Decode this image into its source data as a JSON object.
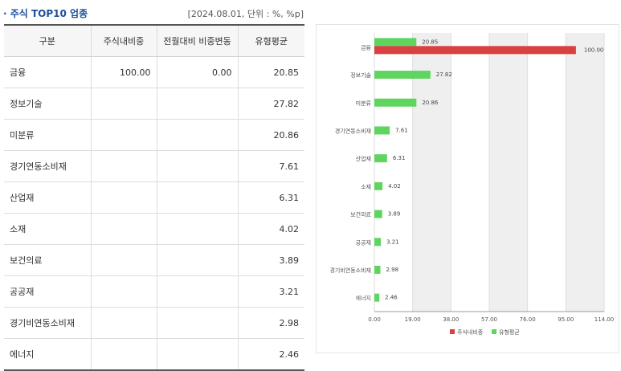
{
  "header": {
    "title": "· 주식 TOP10 업종",
    "unit": "[2024.08.01, 단위 : %, %p]"
  },
  "table": {
    "columns": [
      "구분",
      "주식내비중",
      "전월대비 비중변동",
      "유형평균"
    ],
    "rows": [
      [
        "금융",
        "100.00",
        "0.00",
        "20.85"
      ],
      [
        "정보기술",
        "",
        "",
        "27.82"
      ],
      [
        "미분류",
        "",
        "",
        "20.86"
      ],
      [
        "경기연동소비재",
        "",
        "",
        "7.61"
      ],
      [
        "산업재",
        "",
        "",
        "6.31"
      ],
      [
        "소재",
        "",
        "",
        "4.02"
      ],
      [
        "보건의료",
        "",
        "",
        "3.89"
      ],
      [
        "공공재",
        "",
        "",
        "3.21"
      ],
      [
        "경기비연동소비재",
        "",
        "",
        "2.98"
      ],
      [
        "에너지",
        "",
        "",
        "2.46"
      ]
    ]
  },
  "chart_data": {
    "type": "bar",
    "orientation": "horizontal",
    "categories": [
      "금융",
      "정보기술",
      "미분류",
      "경기연동소비재",
      "산업재",
      "소재",
      "보건의료",
      "공공재",
      "경기비연동소비재",
      "에너지"
    ],
    "series": [
      {
        "name": "주식내비중",
        "color": "#d94040",
        "values": [
          100.0,
          null,
          null,
          null,
          null,
          null,
          null,
          null,
          null,
          null
        ]
      },
      {
        "name": "유형평균",
        "color": "#5fd55f",
        "values": [
          20.85,
          27.82,
          20.86,
          7.61,
          6.31,
          4.02,
          3.89,
          3.21,
          2.98,
          2.46
        ]
      }
    ],
    "xlim": [
      0,
      114
    ],
    "xticks": [
      "0.00",
      "19.00",
      "38.00",
      "57.00",
      "76.00",
      "95.00",
      "114.00"
    ],
    "legend_position": "bottom",
    "grid": "alternating vertical bands"
  }
}
